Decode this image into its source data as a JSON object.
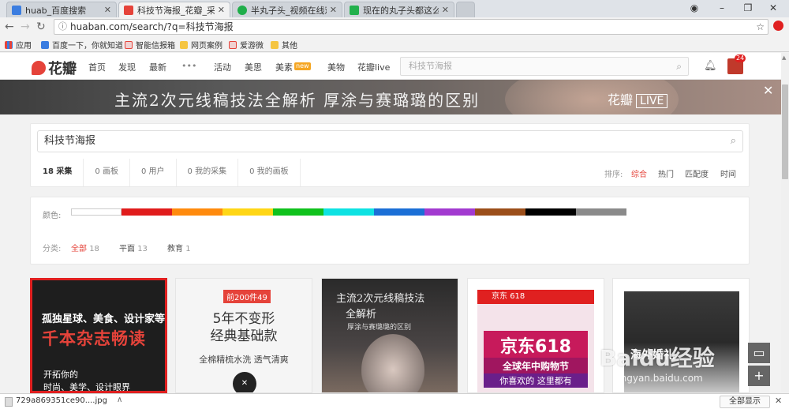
{
  "browser": {
    "tabs": [
      {
        "label": "huab_百度搜索",
        "fav_color": "#3b7de0"
      },
      {
        "label": "科技节海报_花瓣_采集",
        "fav_color": "#e5433a"
      },
      {
        "label": "半丸子头_视频在线观看",
        "fav_color": "#1fae4a"
      },
      {
        "label": "现在的丸子头都这么扎的",
        "fav_color": "#23b14d"
      }
    ],
    "url": "huaban.com/search/?q=科技节海报",
    "bookmarks": [
      "应用",
      "百度一下，你就知道",
      "智能信报箱",
      "网页案例",
      "爱游微",
      "其他"
    ]
  },
  "site": {
    "logo": "花瓣",
    "nav": [
      "首页",
      "发现",
      "最新",
      "•••",
      "活动",
      "美思",
      "美素",
      "美物",
      "花瓣live"
    ],
    "new_badge": "new",
    "search_placeholder": "科技节海报",
    "notification_count": "24"
  },
  "banner": {
    "text": "主流2次元线稿技法全解析  厚涂与赛璐璐的区别",
    "brand": "花瓣",
    "live": "LIVE"
  },
  "search": {
    "query": "科技节海报",
    "filter_tabs": [
      {
        "count": "18",
        "label": "采集"
      },
      {
        "count": "0",
        "label": "画板"
      },
      {
        "count": "0",
        "label": "用户"
      },
      {
        "count": "0",
        "label": "我的采集"
      },
      {
        "count": "0",
        "label": "我的画板"
      }
    ],
    "sort_label": "排序:",
    "sort_options": [
      "综合",
      "热门",
      "匹配度",
      "时间"
    ],
    "color_label": "颜色:",
    "colors": [
      "#ffffff",
      "#e01c1c",
      "#ff8a0d",
      "#ffd616",
      "#10c21d",
      "#0ee2e2",
      "#1b6fd6",
      "#a23ad0",
      "#9b4e1a",
      "#000000",
      "#8a8a8a",
      "#ffffff"
    ],
    "category_label": "分类:",
    "categories": [
      {
        "label": "全部",
        "count": "18"
      },
      {
        "label": "平面",
        "count": "13"
      },
      {
        "label": "教育",
        "count": "1"
      }
    ]
  },
  "pins": {
    "p1": {
      "line1": "孤独星球、美食、设计家等",
      "line2": "千本杂志畅读",
      "line3": "开拓你的",
      "line4": "时尚、美学、设计眼界"
    },
    "p2": {
      "tag": "前200件49",
      "h1": "5年不变形",
      "h2": "经典基础款",
      "h3": "全棉精梳水洗 透气清爽"
    },
    "p3": {
      "line1": "主流2次元线稿技法",
      "line2": "全解析",
      "line3": "厚涂与赛璐璐的区别"
    },
    "p4": {
      "brand": "京东",
      "promo": "618",
      "big": "京东618",
      "mid": "全球年中购物节",
      "low": "你喜欢的 这里都有"
    },
    "p5": {
      "text": "海外婚礼"
    }
  },
  "watermark": {
    "main": "Baidu经验",
    "sub": "jingyan.baidu.com"
  },
  "download": {
    "file": "729a869351ce90....jpg",
    "show_all": "全部显示"
  }
}
